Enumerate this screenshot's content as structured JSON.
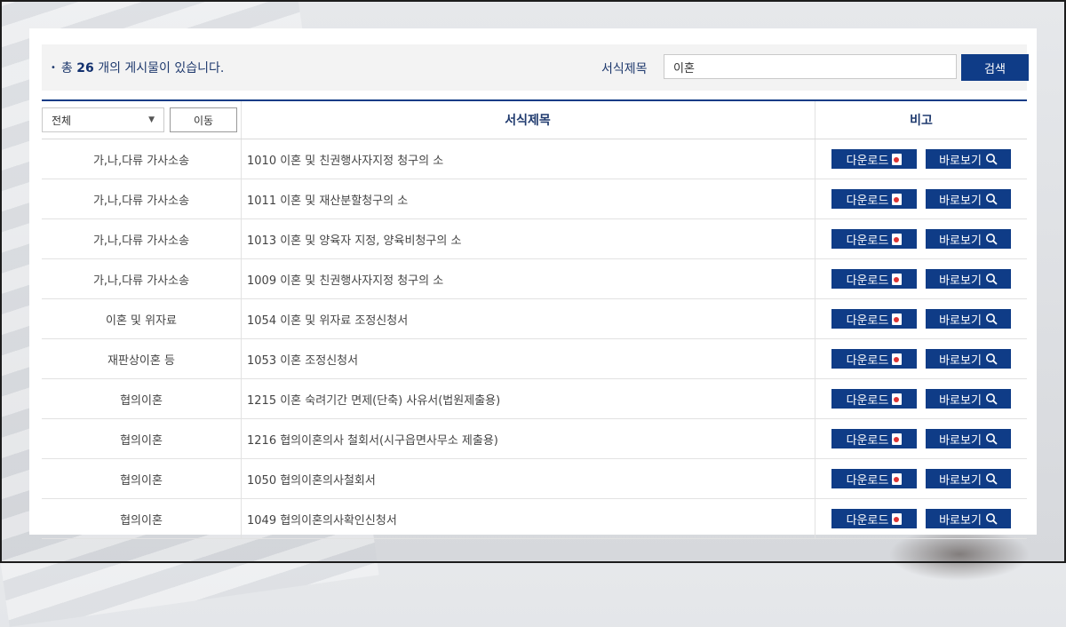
{
  "summary": {
    "prefix": "총",
    "count": "26",
    "suffix": "개의 게시물이 있습니다."
  },
  "search": {
    "label": "서식제목",
    "value": "이혼",
    "button_label": "검색"
  },
  "filter": {
    "selected": "전체",
    "move_label": "이동"
  },
  "columns": {
    "title": "서식제목",
    "note": "비고"
  },
  "actions": {
    "download_label": "다운로드",
    "view_label": "바로보기"
  },
  "rows": [
    {
      "category": "가,나,다류 가사소송",
      "title": "1010 이혼 및 친권행사자지정 청구의 소"
    },
    {
      "category": "가,나,다류 가사소송",
      "title": "1011 이혼 및 재산분할청구의 소"
    },
    {
      "category": "가,나,다류 가사소송",
      "title": "1013 이혼 및 양육자 지정, 양육비청구의 소"
    },
    {
      "category": "가,나,다류 가사소송",
      "title": "1009 이혼 및 친권행사자지정 청구의 소"
    },
    {
      "category": "이혼 및 위자료",
      "title": "1054 이혼 및 위자료 조정신청서"
    },
    {
      "category": "재판상이혼 등",
      "title": "1053 이혼 조정신청서"
    },
    {
      "category": "협의이혼",
      "title": "1215 이혼 숙려기간 면제(단축) 사유서(법원제출용)"
    },
    {
      "category": "협의이혼",
      "title": "1216 협의이혼의사 철회서(시구읍면사무소 제출용)"
    },
    {
      "category": "협의이혼",
      "title": "1050 협의이혼의사철회서"
    },
    {
      "category": "협의이혼",
      "title": "1049 협의이혼의사확인신청서"
    }
  ],
  "colors": {
    "primary": "#0f3c87",
    "text_accent": "#1f3a6e"
  },
  "icons": [
    "file-icon",
    "search-icon",
    "chevron-down-icon"
  ]
}
